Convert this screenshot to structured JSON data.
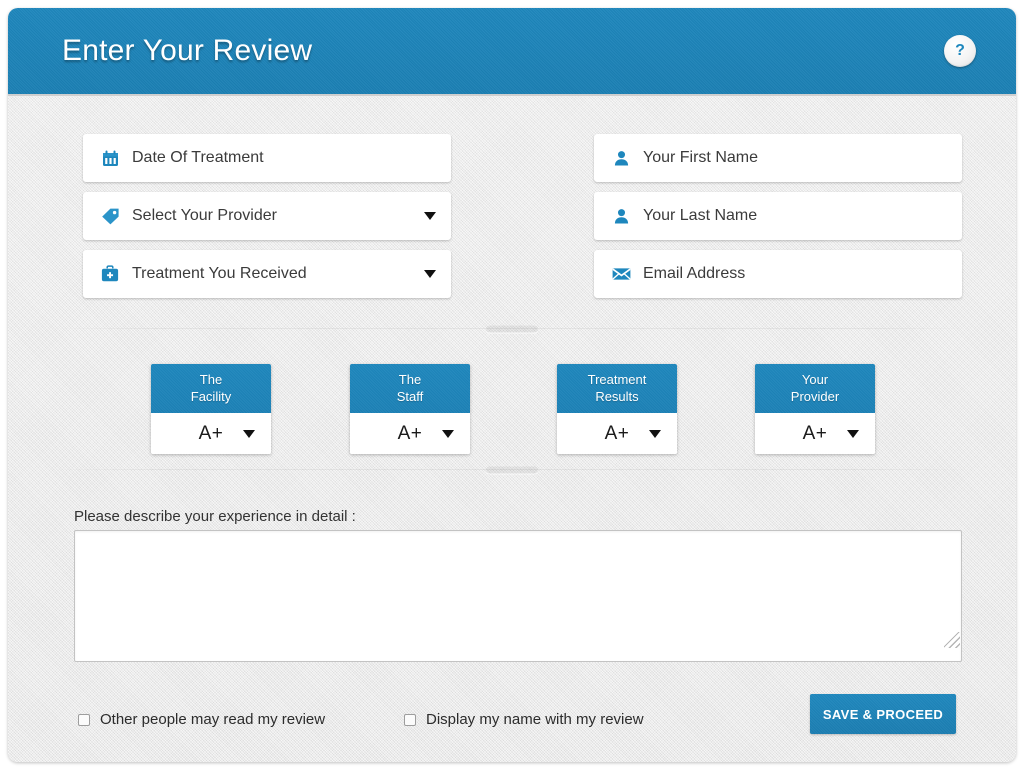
{
  "header": {
    "title": "Enter Your Review",
    "help_icon": "question-mark-icon",
    "accent_color": "#1e87bd"
  },
  "form": {
    "left_fields": [
      {
        "label": "Date Of Treatment",
        "icon": "calendar-icon",
        "type": "date",
        "has_caret": false
      },
      {
        "label": "Select Your Provider",
        "icon": "tag-icon",
        "type": "select",
        "has_caret": true
      },
      {
        "label": "Treatment You Received",
        "icon": "medical-bag-icon",
        "type": "select",
        "has_caret": true
      }
    ],
    "right_fields": [
      {
        "label": "Your First Name",
        "icon": "user-icon",
        "type": "text",
        "has_caret": false
      },
      {
        "label": "Your Last Name",
        "icon": "user-icon",
        "type": "text",
        "has_caret": false
      },
      {
        "label": "Email Address",
        "icon": "envelope-icon",
        "type": "email",
        "has_caret": false
      }
    ]
  },
  "ratings": [
    {
      "line1": "The",
      "line2": "Facility",
      "grade": "A+"
    },
    {
      "line1": "The",
      "line2": "Staff",
      "grade": "A+"
    },
    {
      "line1": "Treatment",
      "line2": "Results",
      "grade": "A+"
    },
    {
      "line1": "Your",
      "line2": "Provider",
      "grade": "A+"
    }
  ],
  "experience": {
    "label": "Please describe your experience in detail :",
    "value": "",
    "placeholder": ""
  },
  "footer": {
    "checkboxes": [
      {
        "label": "Other people may read my review",
        "checked": false
      },
      {
        "label": "Display my name with my review",
        "checked": false
      }
    ],
    "save_label": "SAVE & PROCEED"
  }
}
